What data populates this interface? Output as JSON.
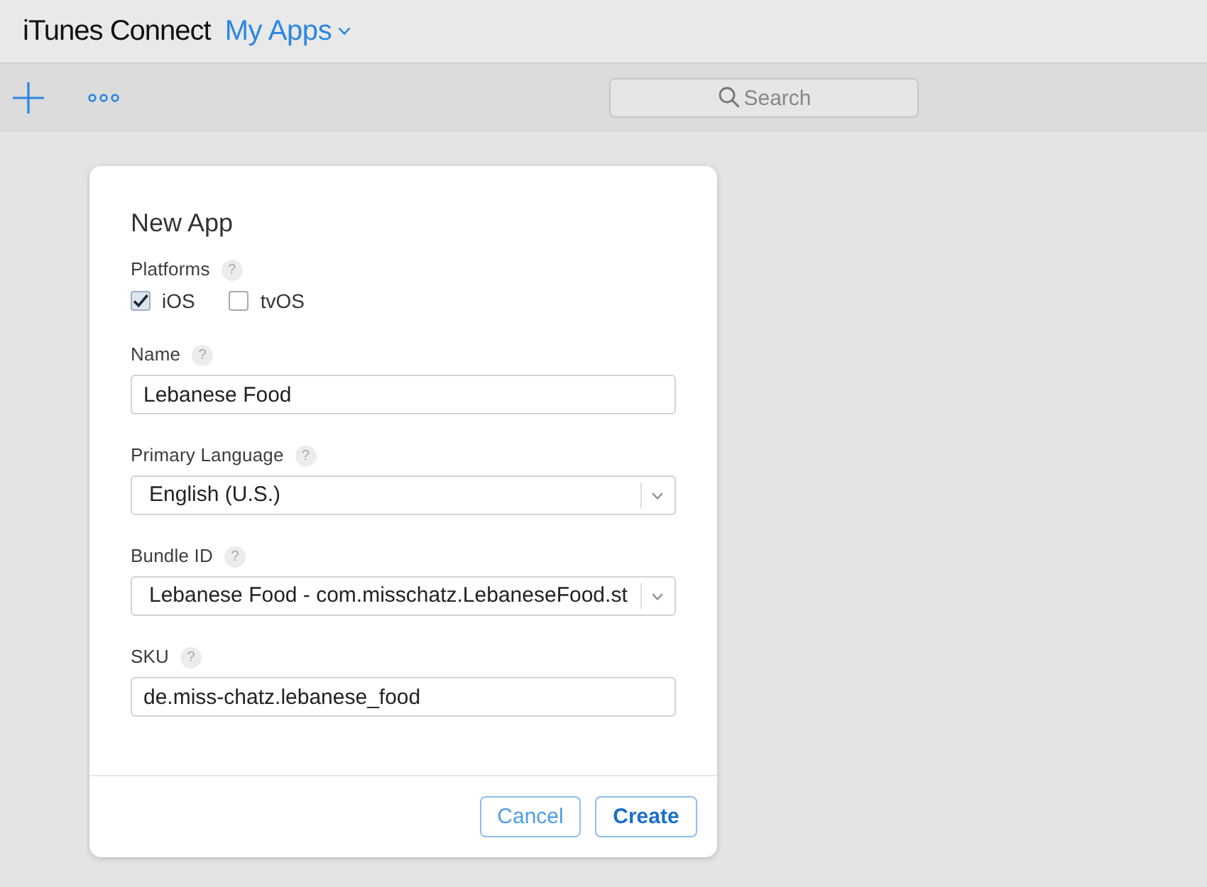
{
  "header": {
    "title": "iTunes Connect",
    "menu": {
      "label": "My Apps"
    }
  },
  "toolbar": {
    "search": {
      "placeholder": "Search"
    }
  },
  "dialog": {
    "title": "New App",
    "fields": [
      {
        "kind": "checkboxes",
        "label": "Platforms",
        "help": "?",
        "options": [
          {
            "label": "iOS",
            "checked": true
          },
          {
            "label": "tvOS",
            "checked": false
          }
        ]
      },
      {
        "kind": "text",
        "label": "Name",
        "help": "?",
        "value": "Lebanese Food"
      },
      {
        "kind": "select",
        "label": "Primary Language",
        "help": "?",
        "value": "English (U.S.)"
      },
      {
        "kind": "select",
        "label": "Bundle ID",
        "help": "?",
        "value": "Lebanese Food - com.misschatz.LebaneseFood.st"
      },
      {
        "kind": "text",
        "label": "SKU",
        "help": "?",
        "value": "de.miss-chatz.lebanese_food"
      }
    ],
    "buttons": [
      {
        "label": "Cancel",
        "kind": "secondary"
      },
      {
        "label": "Create",
        "kind": "primary"
      }
    ]
  }
}
